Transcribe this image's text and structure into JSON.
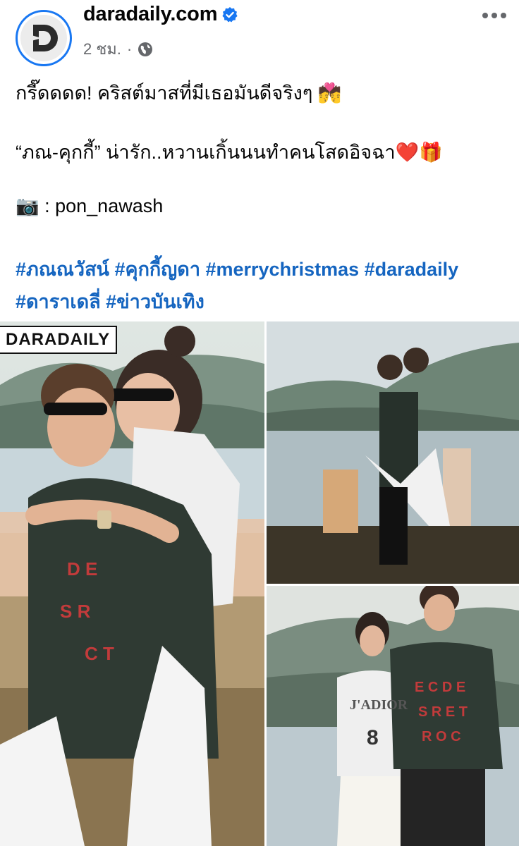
{
  "post": {
    "page_name": "daradaily.com",
    "time": "2 ชม.",
    "dot": "·",
    "lines": {
      "l1": "กรี๊ดดดด! คริสต์มาสที่มีเธอมันดีจริงๆ 💏",
      "l2": "“ภณ-คุกกี้” น่ารัก..หวานเกิ้นนนทำคนโสดอิจฉา❤️🎁",
      "l3": "📷 : pon_nawash"
    },
    "hashtags": {
      "row1": "#ภณณวัสน์ #คุกกี้ญดา #merrychristmas #daradaily",
      "row2": "#ดาราเดลี่ #ข่าวบันเทิง"
    }
  },
  "photos": {
    "watermark": "DARADAILY",
    "shirt_text": "J'ADIOR",
    "shirt_number": "8"
  },
  "icons": {
    "verified": "verified-badge-icon",
    "privacy": "globe-icon",
    "more": "more-options-icon"
  },
  "colors": {
    "accent": "#1877f2",
    "hashtag": "#1565c0",
    "meta": "#65676b"
  }
}
